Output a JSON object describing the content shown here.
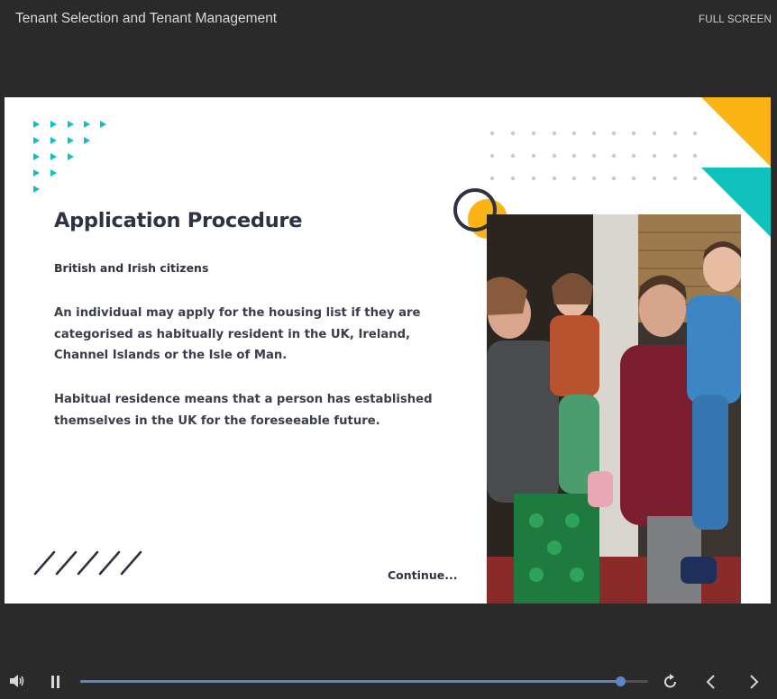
{
  "header": {
    "course_title": "Tenant Selection and Tenant Management",
    "fullscreen_label": "FULL SCREEN"
  },
  "slide": {
    "heading": "Application Procedure",
    "subheading": "British and Irish citizens",
    "paragraph1": "An individual may apply for the housing list if they are categorised as habitually resident in the UK, Ireland, Channel Islands or the Isle of Man.",
    "paragraph2": "Habitual residence means that a person has established themselves in the UK for the foreseeable future.",
    "continue_label": "Continue...",
    "photo_icon": "family-photo",
    "colors": {
      "teal": "#0fc2bd",
      "yellow": "#fbb315",
      "navy": "#2f3242"
    }
  },
  "player": {
    "progress": 0.95,
    "progress_color": "#5b86c9",
    "icons": [
      "volume-icon",
      "pause-icon",
      "replay-icon",
      "previous-icon",
      "next-icon"
    ]
  }
}
